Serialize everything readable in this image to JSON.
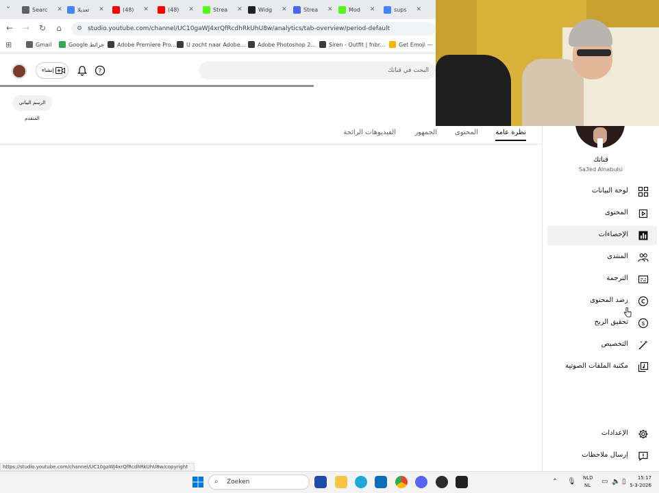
{
  "browser": {
    "tabs": [
      {
        "label": "Searc",
        "color": "#5f6368"
      },
      {
        "label": "تعديلا",
        "color": "#4285f4"
      },
      {
        "label": "(48)",
        "color": "#ff0000"
      },
      {
        "label": "(48)",
        "color": "#ff0000"
      },
      {
        "label": "Strea",
        "color": "#53fc18"
      },
      {
        "label": "Widg",
        "color": "#202124"
      },
      {
        "label": "Strea",
        "color": "#4a66f0"
      },
      {
        "label": "Mod",
        "color": "#53fc18"
      },
      {
        "label": "sups",
        "color": "#4285f4"
      }
    ],
    "url": "studio.youtube.com/channel/UC10gaWJ4xrQfRcdhRkUhU8w/analytics/tab-overview/period-default",
    "bookmarks": [
      {
        "label": "Gmail",
        "color": "#5f6368"
      },
      {
        "label": "Google خرائط",
        "color": "#34a853"
      },
      {
        "label": "Adobe Premiere Pro...",
        "color": "#3c3c3c"
      },
      {
        "label": "U zocht naar Adobe...",
        "color": "#3c3c3c"
      },
      {
        "label": "Adobe Photoshop 2...",
        "color": "#3c3c3c"
      },
      {
        "label": "Siren - Outfit | fnbr...",
        "color": "#3c3c3c"
      },
      {
        "label": "Get Emoji —",
        "color": "#5f6368"
      },
      {
        "label": "Get Emoji —",
        "color": "#f4b400"
      }
    ]
  },
  "header": {
    "create_label": "إنشاء",
    "search_placeholder": "البحث في قناتك"
  },
  "filter_chip": "الرسم البياني المتقدم",
  "tabs": [
    {
      "label": "نظرة عامة",
      "active": true
    },
    {
      "label": "المحتوى",
      "active": false
    },
    {
      "label": "الجمهور",
      "active": false
    },
    {
      "label": "الفيديوهات الرائجة",
      "active": false
    }
  ],
  "channel": {
    "title": "قناتك",
    "name": "Sa3ed Alnabulsi"
  },
  "sidebar": {
    "items": [
      {
        "label": "لوحة البيانات",
        "icon": "dashboard-icon",
        "active": false
      },
      {
        "label": "المحتوى",
        "icon": "content-icon",
        "active": false
      },
      {
        "label": "الإحصاءات",
        "icon": "analytics-icon",
        "active": true
      },
      {
        "label": "المنتدى",
        "icon": "community-icon",
        "active": false
      },
      {
        "label": "الترجمة",
        "icon": "subtitles-icon",
        "active": false
      },
      {
        "label": "رصد المحتوى",
        "icon": "copyright-icon",
        "active": false
      },
      {
        "label": "تحقيق الربح",
        "icon": "monetization-icon",
        "active": false
      },
      {
        "label": "التخصيص",
        "icon": "customization-icon",
        "active": false
      },
      {
        "label": "مكتبة الملفات الصوتية",
        "icon": "audio-library-icon",
        "active": false
      }
    ],
    "bottom": [
      {
        "label": "الإعدادات",
        "icon": "settings-icon"
      },
      {
        "label": "إرسال ملاحظات",
        "icon": "feedback-icon"
      }
    ]
  },
  "status_url": "https://studio.youtube.com/channel/UC10gaWJ4xrQfRcdhRkUhU8w/copyright",
  "taskbar": {
    "search_label": "Zoeken",
    "lang_top": "NLD",
    "lang_bottom": "NL",
    "time": "15:17",
    "date": "5-3-2026"
  }
}
